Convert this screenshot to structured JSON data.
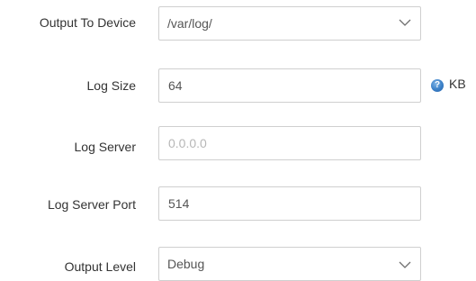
{
  "form": {
    "output_to_device": {
      "label": "Output To Device",
      "value": "/var/log/",
      "icon": "chevron-down-icon"
    },
    "log_size": {
      "label": "Log Size",
      "value": "64",
      "unit": "KB",
      "help_icon": "help-icon",
      "help_glyph": "?"
    },
    "log_server": {
      "label": "Log Server",
      "value": "",
      "placeholder": "0.0.0.0"
    },
    "log_server_port": {
      "label": "Log Server Port",
      "value": "514"
    },
    "output_level": {
      "label": "Output Level",
      "value": "Debug",
      "icon": "chevron-down-icon"
    }
  }
}
